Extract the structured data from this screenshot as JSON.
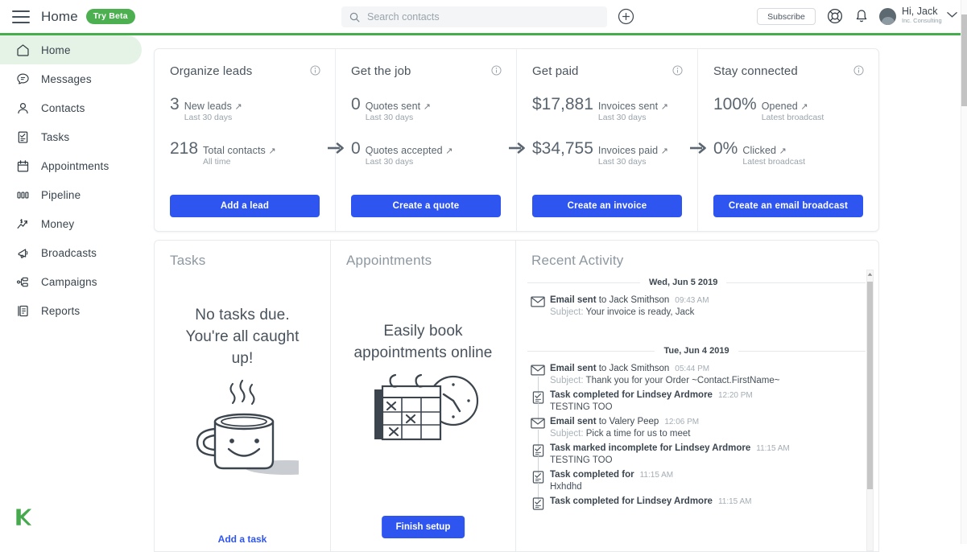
{
  "topbar": {
    "menu_icon": "hamburger-icon",
    "title": "Home",
    "beta_badge": "Try Beta",
    "search_placeholder": "Search contacts",
    "search_value": "",
    "search_icon": "search-icon",
    "add_icon": "plus-circle-icon",
    "subscribe_label": "Subscribe",
    "help_icon": "lifebuoy-icon",
    "notifications_icon": "bell-icon",
    "avatar_icon": "user-avatar",
    "user_name": "Hi, Jack",
    "user_org": "Inc. Consulting",
    "chevron_icon": "chevron-down-icon",
    "accent_green": "#45ad4b"
  },
  "sidebar": {
    "items": [
      {
        "label": "Home",
        "icon": "home-icon",
        "active": true
      },
      {
        "label": "Messages",
        "icon": "chat-bubble-icon",
        "active": false
      },
      {
        "label": "Contacts",
        "icon": "person-icon",
        "active": false
      },
      {
        "label": "Tasks",
        "icon": "clipboard-check-icon",
        "active": false
      },
      {
        "label": "Appointments",
        "icon": "calendar-icon",
        "active": false
      },
      {
        "label": "Pipeline",
        "icon": "pipeline-bars-icon",
        "active": false
      },
      {
        "label": "Money",
        "icon": "money-trend-icon",
        "active": false
      },
      {
        "label": "Broadcasts",
        "icon": "megaphone-icon",
        "active": false
      },
      {
        "label": "Campaigns",
        "icon": "campaign-nodes-icon",
        "active": false
      },
      {
        "label": "Reports",
        "icon": "report-document-icon",
        "active": false
      }
    ],
    "logo": "keap-logo",
    "active_bg": "#e4f3e6"
  },
  "cards": [
    {
      "title": "Organize leads",
      "info_icon": "info-icon",
      "stats": [
        {
          "value": "3",
          "label": "New leads",
          "arrow": "↗",
          "sub": "Last 30 days"
        },
        {
          "value": "218",
          "label": "Total contacts",
          "arrow": "↗",
          "sub": "All time"
        }
      ],
      "button": "Add a lead"
    },
    {
      "title": "Get the job",
      "info_icon": "info-icon",
      "stats": [
        {
          "value": "0",
          "label": "Quotes sent",
          "arrow": "↗",
          "sub": "Last 30 days"
        },
        {
          "value": "0",
          "label": "Quotes accepted",
          "arrow": "↗",
          "sub": "Last 30 days"
        }
      ],
      "button": "Create a quote"
    },
    {
      "title": "Get paid",
      "info_icon": "info-icon",
      "stats": [
        {
          "value": "$17,881",
          "label": "Invoices sent",
          "arrow": "↗",
          "sub": "Last 30 days"
        },
        {
          "value": "$34,755",
          "label": "Invoices paid",
          "arrow": "↗",
          "sub": "Last 30 days"
        }
      ],
      "button": "Create an invoice"
    },
    {
      "title": "Stay connected",
      "info_icon": "info-icon",
      "stats": [
        {
          "value": "100%",
          "label": "Opened",
          "arrow": "↗",
          "sub": "Latest broadcast"
        },
        {
          "value": "0%",
          "label": "Clicked",
          "arrow": "↗",
          "sub": "Latest broadcast"
        }
      ],
      "button": "Create an email broadcast"
    }
  ],
  "card_button_color": "#2f55f0",
  "tasks": {
    "title": "Tasks",
    "empty_message": "No tasks due. You're all caught up!",
    "illustration": "coffee-mug-illustration",
    "add_link": "Add a task"
  },
  "appointments": {
    "title": "Appointments",
    "empty_message": "Easily book appointments online",
    "illustration": "calendar-clock-illustration",
    "button": "Finish setup"
  },
  "activity": {
    "title": "Recent Activity",
    "groups": [
      {
        "date": "Wed, Jun 5 2019",
        "items": [
          {
            "icon": "envelope-icon",
            "bold": "Email sent",
            "rest": " to Jack Smithson",
            "time": "09:43 AM",
            "sub_key": "Subject: ",
            "sub_val": "Your invoice is ready, Jack",
            "connector": false
          }
        ]
      },
      {
        "date": "Tue, Jun 4 2019",
        "items": [
          {
            "icon": "envelope-icon",
            "bold": "Email sent",
            "rest": " to Jack Smithson",
            "time": "05:44 PM",
            "sub_key": "Subject: ",
            "sub_val": "Thank you for your Order ~Contact.FirstName~",
            "connector": true
          },
          {
            "icon": "task-check-icon",
            "bold": "Task completed for Lindsey Ardmore",
            "rest": "",
            "time": "12:20 PM",
            "sub_key": "",
            "sub_val": "TESTING TOO",
            "connector": true
          },
          {
            "icon": "envelope-icon",
            "bold": "Email sent",
            "rest": " to Valery Peep",
            "time": "12:06 PM",
            "sub_key": "Subject: ",
            "sub_val": "Pick a time for us to meet",
            "connector": true
          },
          {
            "icon": "task-check-icon",
            "bold": "Task marked incomplete for Lindsey Ardmore",
            "rest": "",
            "time": "11:15 AM",
            "sub_key": "",
            "sub_val": "TESTING TOO",
            "connector": true
          },
          {
            "icon": "task-check-icon",
            "bold": "Task completed for",
            "rest": "",
            "time": "11:15 AM",
            "sub_key": "",
            "sub_val": "Hxhdhd",
            "connector": true
          },
          {
            "icon": "task-check-icon",
            "bold": "Task completed for Lindsey Ardmore",
            "rest": "",
            "time": "11:15 AM",
            "sub_key": "",
            "sub_val": "",
            "connector": false
          }
        ]
      }
    ]
  }
}
